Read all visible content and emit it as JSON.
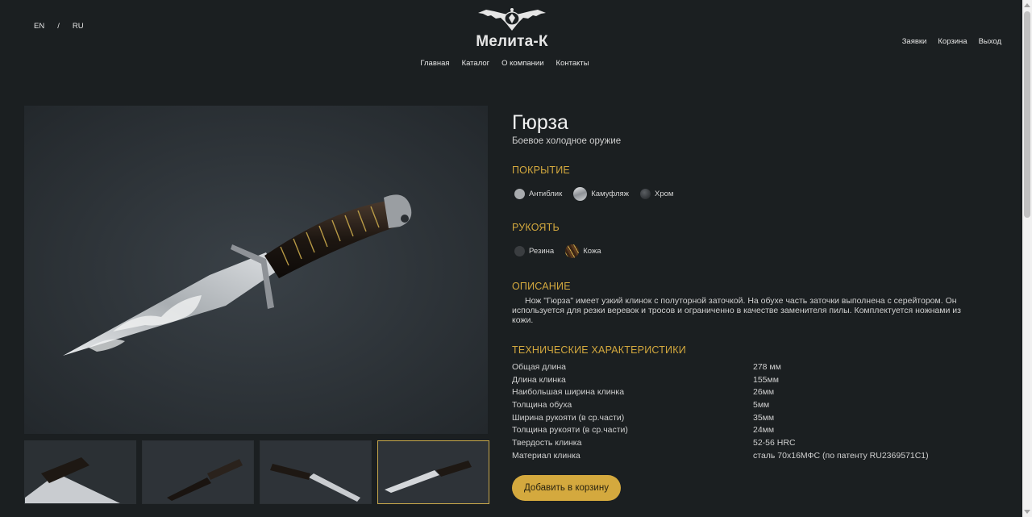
{
  "lang": {
    "en": "EN",
    "sep": "/",
    "ru": "RU"
  },
  "brand": {
    "name": "Мелита-К"
  },
  "nav": {
    "items": [
      "Главная",
      "Каталог",
      "О компании",
      "Контакты"
    ]
  },
  "user_nav": {
    "items": [
      "Заявки",
      "Корзина",
      "Выход"
    ]
  },
  "product": {
    "title": "Гюрза",
    "subtitle": "Боевое холодное оружие"
  },
  "coating": {
    "heading": "ПОКРЫТИЕ",
    "options": [
      "Антиблик",
      "Камуфляж",
      "Хром"
    ]
  },
  "handle": {
    "heading": "РУКОЯТЬ",
    "options": [
      "Резина",
      "Кожа"
    ]
  },
  "description": {
    "heading": "ОПИСАНИЕ",
    "text": "Нож \"Гюрза\" имеет узкий клинок с полуторной заточкой. На обухе часть заточки выполнена с серейтором. Он используется для резки веревок и тросов и ограниченно в качестве заменителя пилы. Комплектуется ножнами из кожи."
  },
  "specs": {
    "heading": "ТЕХНИЧЕСКИЕ ХАРАКТЕРИСТИКИ",
    "rows": [
      {
        "k": "Общая длина",
        "v": "278 мм"
      },
      {
        "k": "Длина клинка",
        "v": "155мм"
      },
      {
        "k": "Наибольшая ширина клинка",
        "v": "26мм"
      },
      {
        "k": "Толщина обуха",
        "v": "5мм"
      },
      {
        "k": "Ширина рукояти (в ср.части)",
        "v": "35мм"
      },
      {
        "k": "Толщина рукояти (в ср.части)",
        "v": "24мм"
      },
      {
        "k": "Твердость клинка",
        "v": "52-56 HRC"
      },
      {
        "k": "Материал клинка",
        "v": "сталь 70х16МФС (по патенту RU2369571C1)"
      }
    ]
  },
  "cart": {
    "add_label": "Добавить в корзину"
  },
  "colors": {
    "accent": "#d4a93e",
    "background": "#1b1f21"
  }
}
